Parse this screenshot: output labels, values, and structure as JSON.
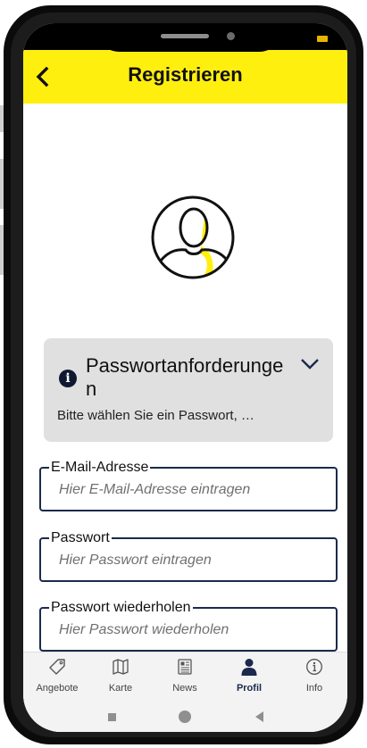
{
  "header": {
    "title": "Registrieren",
    "back_icon": "chevron-left-icon"
  },
  "avatar": {
    "icon": "user-avatar-icon",
    "accent": "#ffef0f"
  },
  "info_card": {
    "icon": "info-icon",
    "title": "Passwortanforderungen",
    "subtitle": "Bitte wählen Sie ein Passwort, …",
    "chevron": "chevron-down-icon"
  },
  "form": {
    "email": {
      "label": "E-Mail-Adresse",
      "placeholder": "Hier E-Mail-Adresse eintragen",
      "value": ""
    },
    "password": {
      "label": "Passwort",
      "placeholder": "Hier Passwort eintragen",
      "value": ""
    },
    "password_repeat": {
      "label": "Passwort wiederholen",
      "placeholder": "Hier Passwort wiederholen",
      "value": ""
    }
  },
  "tabs": [
    {
      "label": "Angebote",
      "icon": "tag-icon",
      "active": false
    },
    {
      "label": "Karte",
      "icon": "map-icon",
      "active": false
    },
    {
      "label": "News",
      "icon": "newspaper-icon",
      "active": false
    },
    {
      "label": "Profil",
      "icon": "person-icon",
      "active": true
    },
    {
      "label": "Info",
      "icon": "info-circle-icon",
      "active": false
    }
  ],
  "colors": {
    "brand_yellow": "#ffef0f",
    "navy": "#1b2a4c",
    "card_grey": "#e0e0e0"
  }
}
